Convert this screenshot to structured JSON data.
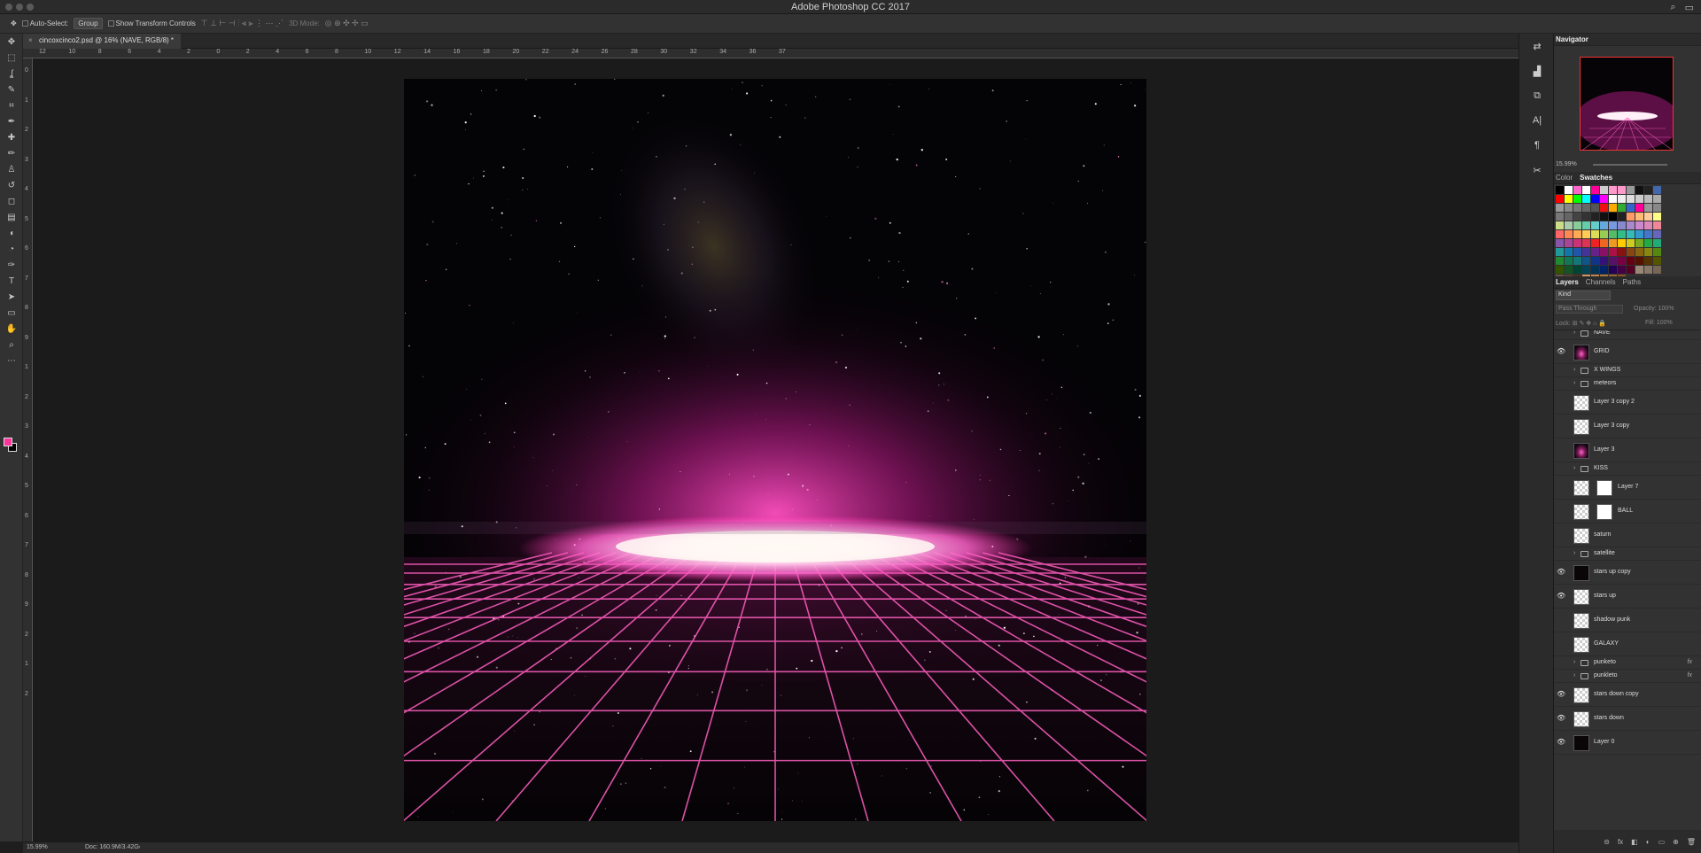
{
  "app": {
    "title": "Adobe Photoshop CC 2017"
  },
  "options": {
    "auto_select_label": "Auto-Select:",
    "auto_select_value": "Group",
    "transform_label": "Show Transform Controls",
    "mode_label": "3D Mode:"
  },
  "document": {
    "tab_label": "cincoxcinco2.psd @ 16% (NAVE, RGB/8) *",
    "close_glyph": "×"
  },
  "rulers": {
    "h_ticks": [
      "12",
      "10",
      "8",
      "6",
      "4",
      "2",
      "0",
      "2",
      "4",
      "6",
      "8",
      "10",
      "12",
      "14",
      "16",
      "18",
      "20",
      "22",
      "24",
      "26",
      "28",
      "30",
      "32",
      "34",
      "36",
      "37"
    ],
    "v_ticks": [
      "0",
      "1",
      "2",
      "3",
      "4",
      "5",
      "6",
      "7",
      "8",
      "9",
      "1",
      "2",
      "3",
      "4",
      "5",
      "6",
      "7",
      "8",
      "9",
      "2",
      "1",
      "2"
    ]
  },
  "tools": [
    "move-icon",
    "marquee-icon",
    "lasso-icon",
    "quick-select-icon",
    "crop-icon",
    "eyedropper-icon",
    "healing-icon",
    "brush-icon",
    "stamp-icon",
    "history-brush-icon",
    "eraser-icon",
    "gradient-icon",
    "blur-icon",
    "dodge-icon",
    "pen-icon",
    "type-icon",
    "path-select-icon",
    "rectangle-icon",
    "hand-icon",
    "zoom-icon",
    "more-icon"
  ],
  "colors": {
    "foreground": "#ff3399",
    "background": "#000000",
    "accent": "#e33333"
  },
  "status": {
    "zoom": "15.99%",
    "doc": "Doc: 160.9M/3.42G"
  },
  "navigator": {
    "title": "Navigator",
    "zoom": "15.99%"
  },
  "swatches": {
    "tabs": [
      "Color",
      "Swatches"
    ],
    "active_tab": "Swatches",
    "colors": [
      "#000000",
      "#ffffff",
      "#ff66cc",
      "#ffffff",
      "#ff0099",
      "#cccccc",
      "#ff99cc",
      "#ff99cc",
      "#999999",
      "#111111",
      "#222222",
      "#4466aa",
      "#ff0000",
      "#ffff00",
      "#00ff00",
      "#00ffff",
      "#0000ff",
      "#ff00ff",
      "#ffffff",
      "#eeeeee",
      "#dddddd",
      "#cccccc",
      "#bbbbbb",
      "#aaaaaa",
      "#999999",
      "#888888",
      "#777777",
      "#666666",
      "#555555",
      "#ee1111",
      "#ffaa00",
      "#33aa33",
      "#3366cc",
      "#ff0099",
      "#999999",
      "#888888",
      "#777777",
      "#666666",
      "#444444",
      "#333333",
      "#222222",
      "#111111",
      "#000000",
      "#222222",
      "#ff9966",
      "#ffbb77",
      "#ffcc99",
      "#ffff88",
      "#ccdd88",
      "#aaccaa",
      "#88cc99",
      "#66ccaa",
      "#66cccc",
      "#66aadd",
      "#7799dd",
      "#8888cc",
      "#aa88cc",
      "#cc88cc",
      "#dd88bb",
      "#ee8899",
      "#ff6666",
      "#ff8855",
      "#ffaa55",
      "#ffcc55",
      "#dddd55",
      "#99cc55",
      "#55bb66",
      "#33bb88",
      "#33bbbb",
      "#3399cc",
      "#4477cc",
      "#6666bb",
      "#8855aa",
      "#aa4499",
      "#cc3377",
      "#dd3355",
      "#ee2222",
      "#ee6622",
      "#ee9922",
      "#ffcc00",
      "#cccc22",
      "#77aa22",
      "#22aa44",
      "#22aa77",
      "#229999",
      "#1177aa",
      "#2255aa",
      "#443399",
      "#662288",
      "#881166",
      "#aa1144",
      "#881111",
      "#884411",
      "#886611",
      "#888811",
      "#558811",
      "#228833",
      "#117755",
      "#117777",
      "#115588",
      "#113388",
      "#331177",
      "#551166",
      "#770044",
      "#660011",
      "#551100",
      "#553300",
      "#555500",
      "#335500",
      "#115522",
      "#004433",
      "#004455",
      "#003355",
      "#002266",
      "#220055",
      "#440044",
      "#550022",
      "#998877",
      "#887766",
      "#776655",
      "#665544",
      "#554433",
      "#443322",
      "#cc9966",
      "#bb8855",
      "#aa7744",
      "#996633",
      "#885522"
    ]
  },
  "layers_panel": {
    "tabs": [
      "Layers",
      "Channels",
      "Paths"
    ],
    "active_tab": "Layers",
    "filter": "Kind",
    "blend_mode": "Pass Through",
    "opacity_label": "Opacity:",
    "opacity": "100%",
    "lock_label": "Lock:",
    "fill_label": "Fill:",
    "fill": "100%",
    "items": [
      {
        "name": "NAVE",
        "type": "group",
        "visible": false
      },
      {
        "name": "GRID",
        "type": "glow",
        "visible": true
      },
      {
        "name": "X WINGS",
        "type": "group",
        "visible": false
      },
      {
        "name": "meteors",
        "type": "group",
        "visible": false
      },
      {
        "name": "Layer 3 copy 2",
        "type": "layer",
        "visible": false
      },
      {
        "name": "Layer 3 copy",
        "type": "layer",
        "visible": false
      },
      {
        "name": "Layer 3",
        "type": "glow",
        "visible": false
      },
      {
        "name": "KISS",
        "type": "group",
        "visible": false
      },
      {
        "name": "Layer 7",
        "type": "masked",
        "visible": false
      },
      {
        "name": "BALL",
        "type": "masked",
        "visible": false
      },
      {
        "name": "saturn",
        "type": "layer",
        "visible": false
      },
      {
        "name": "satellite",
        "type": "group",
        "visible": false
      },
      {
        "name": "stars up copy",
        "type": "dark",
        "visible": true
      },
      {
        "name": "stars up",
        "type": "layer",
        "visible": true
      },
      {
        "name": "shadow punk",
        "type": "layer",
        "visible": false
      },
      {
        "name": "GALAXY",
        "type": "layer",
        "visible": false
      },
      {
        "name": "punketo",
        "type": "group",
        "visible": false,
        "fx": "fx"
      },
      {
        "name": "punkleto",
        "type": "group",
        "visible": false,
        "fx": "fx"
      },
      {
        "name": "stars down copy",
        "type": "layer",
        "visible": true
      },
      {
        "name": "stars down",
        "type": "layer",
        "visible": true
      },
      {
        "name": "Layer 0",
        "type": "dark",
        "visible": true
      }
    ]
  }
}
